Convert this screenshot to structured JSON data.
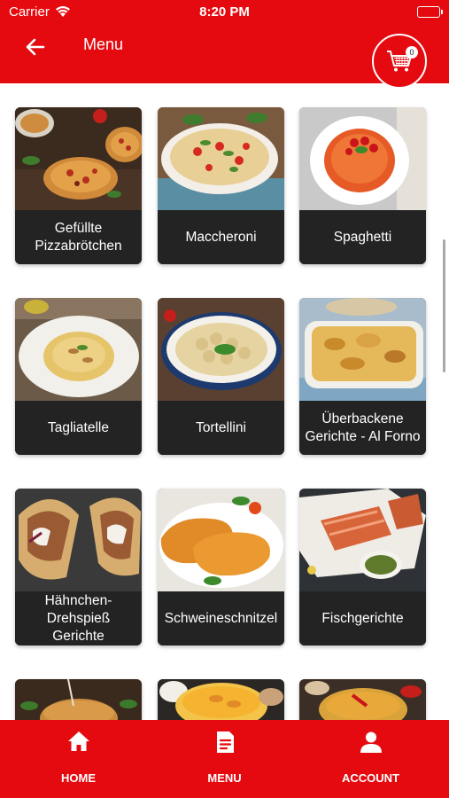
{
  "status_bar": {
    "carrier": "Carrier",
    "time": "8:20 PM"
  },
  "header": {
    "title": "Menu",
    "cart_count": "0"
  },
  "categories": [
    {
      "label": "Gefüllte Pizzabrötchen",
      "image": "stuffed-pizza-rolls-photo"
    },
    {
      "label": "Maccheroni",
      "image": "maccheroni-salad-photo"
    },
    {
      "label": "Spaghetti",
      "image": "spaghetti-tomato-photo"
    },
    {
      "label": "Tagliatelle",
      "image": "tagliatelle-plate-photo"
    },
    {
      "label": "Tortellini",
      "image": "tortellini-bowl-photo"
    },
    {
      "label": "Überbackene Gerichte - Al Forno",
      "image": "baked-casserole-photo"
    },
    {
      "label": "Hähnchen-Drehspieß Gerichte",
      "image": "chicken-doner-wrap-photo"
    },
    {
      "label": "Schweineschnitzel",
      "image": "pork-schnitzel-photo"
    },
    {
      "label": "Fischgerichte",
      "image": "salmon-fish-photo"
    },
    {
      "label": "",
      "image": "burger-photo"
    },
    {
      "label": "",
      "image": "curry-bowl-photo"
    },
    {
      "label": "",
      "image": "soup-bowl-photo"
    }
  ],
  "bottom_nav": [
    {
      "label": "HOME",
      "icon": "home-icon"
    },
    {
      "label": "MENU",
      "icon": "menu-list-icon"
    },
    {
      "label": "ACCOUNT",
      "icon": "account-icon"
    }
  ],
  "colors": {
    "primary": "#e50a0f",
    "card_label_bg": "#232323",
    "text_on_primary": "#ffffff"
  }
}
